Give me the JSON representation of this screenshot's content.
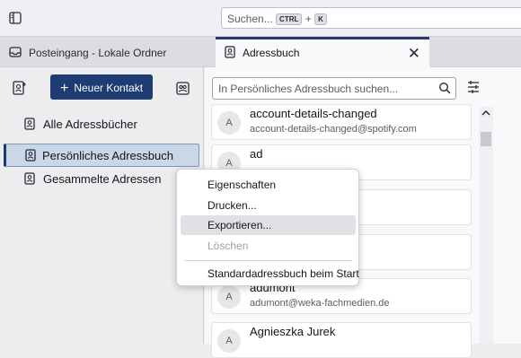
{
  "topbar": {
    "app_icon": "spaces-toggle-icon",
    "search_placeholder": "Suchen...",
    "shortcut_key1": "CTRL",
    "shortcut_plus": "+",
    "shortcut_key2": "K"
  },
  "tabs": [
    {
      "label": "Posteingang - Lokale Ordner",
      "icon": "mail-folder-icon"
    },
    {
      "label": "Adressbuch",
      "icon": "address-book-icon",
      "close": "✕"
    }
  ],
  "sidebar": {
    "new_contact_label": "Neuer Kontakt",
    "new_contact_plus": "+",
    "books": [
      {
        "label": "Alle Adressbücher"
      },
      {
        "label": "Persönliches Adressbuch"
      },
      {
        "label": "Gesammelte Adressen"
      }
    ]
  },
  "list": {
    "search_placeholder": "In Persönliches Adressbuch suchen...",
    "contacts": [
      {
        "initial": "A",
        "name": "account-details-changed",
        "email": "account-details-changed@spotify.com"
      },
      {
        "initial": "A",
        "name": "ad",
        "email": ""
      },
      {
        "initial": "A",
        "name": "",
        "email": ""
      },
      {
        "initial": "A",
        "name": "",
        "email": ""
      },
      {
        "initial": "A",
        "name": "adumont",
        "email": "adumont@weka-fachmedien.de"
      },
      {
        "initial": "A",
        "name": "Agnieszka Jurek",
        "email": ""
      }
    ]
  },
  "context_menu": {
    "items": [
      {
        "label": "Eigenschaften"
      },
      {
        "label": "Drucken..."
      },
      {
        "label": "Exportieren..."
      },
      {
        "label": "Löschen"
      },
      {
        "label": "Standardadressbuch beim Start"
      }
    ]
  },
  "colors": {
    "accent": "#1e3b73",
    "selected_bg": "#cbd7e6",
    "menu_highlight": "#e0e0e6"
  }
}
